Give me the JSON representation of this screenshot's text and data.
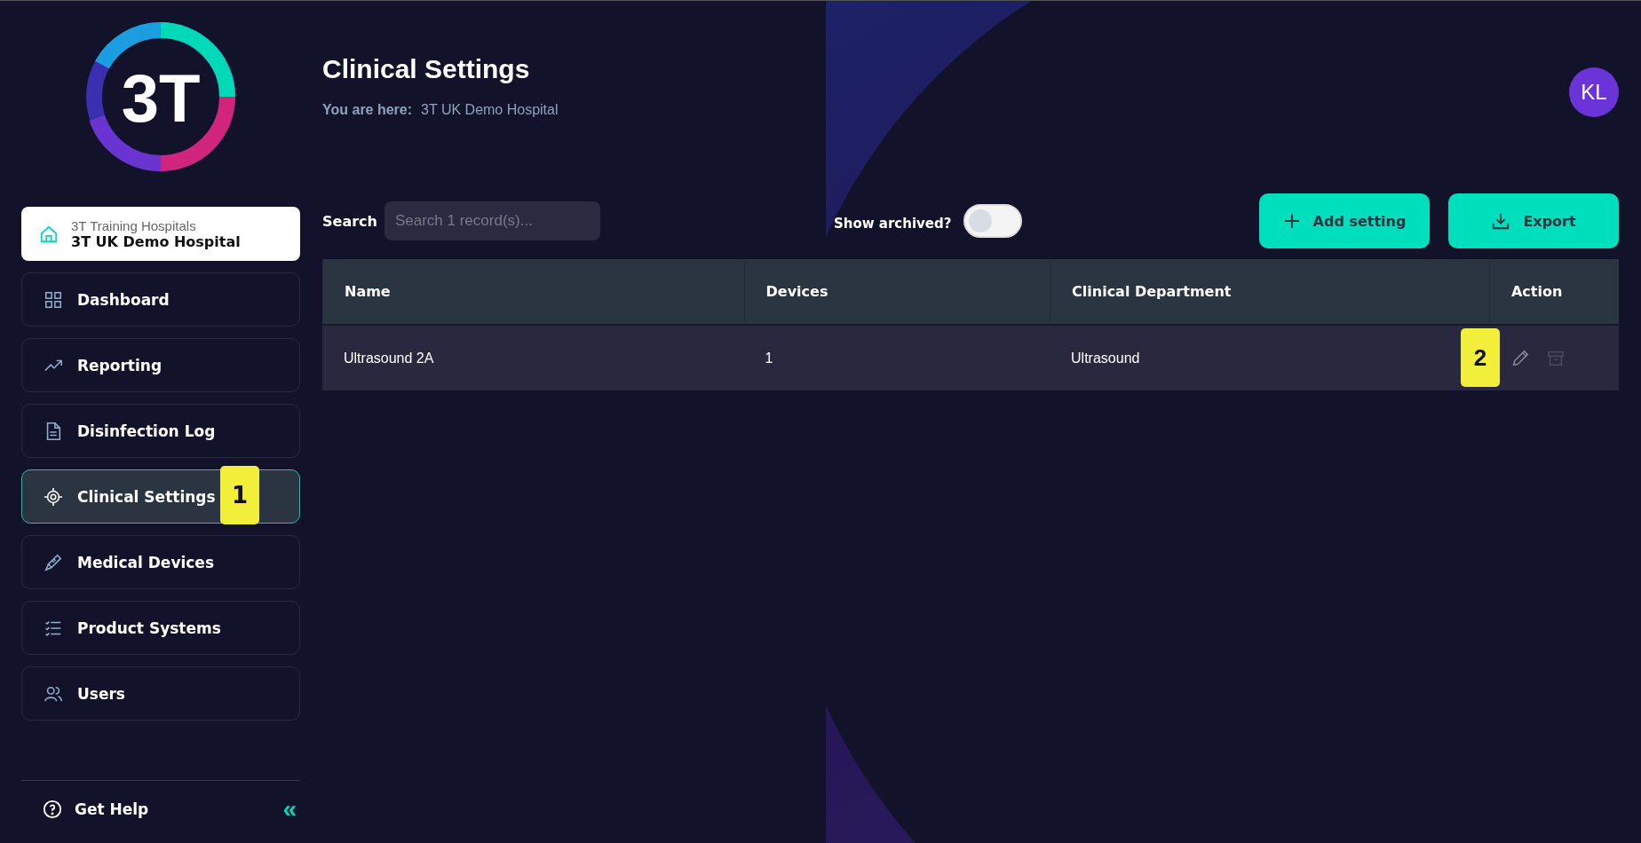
{
  "logo": {
    "text": "3T"
  },
  "hospital": {
    "group": "3T Training Hospitals",
    "name": "3T UK Demo Hospital"
  },
  "nav": [
    {
      "label": "Dashboard",
      "kind": "grid",
      "selected": false
    },
    {
      "label": "Reporting",
      "kind": "trend",
      "selected": false
    },
    {
      "label": "Disinfection Log",
      "kind": "document",
      "selected": false
    },
    {
      "label": "Clinical Settings",
      "kind": "target",
      "selected": true,
      "callout": "1"
    },
    {
      "label": "Medical Devices",
      "kind": "probe",
      "selected": false
    },
    {
      "label": "Product Systems",
      "kind": "checklist",
      "selected": false
    },
    {
      "label": "Users",
      "kind": "users",
      "selected": false
    }
  ],
  "help": {
    "label": "Get Help",
    "collapse": "«"
  },
  "header": {
    "title": "Clinical Settings",
    "breadcrumb_label": "You are here:",
    "breadcrumb": "3T UK Demo Hospital",
    "avatar": "KL"
  },
  "toolbar": {
    "search_label": "Search",
    "placeholder": "Search 1 record(s)...",
    "archived_label": "Show archived?",
    "archived_on": false,
    "buttons": [
      {
        "label": "Add setting",
        "kind": "add"
      },
      {
        "label": "Export",
        "kind": "export"
      }
    ]
  },
  "table": {
    "columns": [
      "Name",
      "Devices",
      "Clinical Department",
      "Action"
    ],
    "rows": [
      {
        "cells": [
          "Ultrasound 2A",
          "1",
          "Ultrasound"
        ],
        "edit_disabled": false,
        "archive_disabled": true,
        "callout": "2"
      }
    ]
  }
}
